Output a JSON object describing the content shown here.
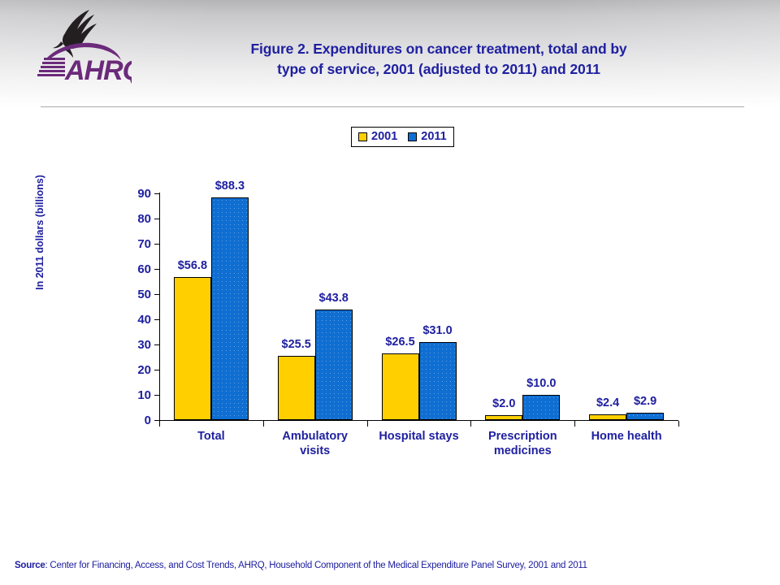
{
  "header": {
    "logo_alt": "AHRQ Agency for Healthcare Research and Quality",
    "title_line1": "Figure 2. Expenditures on cancer treatment, total and by",
    "title_line2": "type of service, 2001 (adjusted to 2011) and 2011"
  },
  "legend": {
    "items": [
      {
        "label": "2001",
        "color": "#ffcf00"
      },
      {
        "label": "2011",
        "color": "#0f6ed2"
      }
    ]
  },
  "source": {
    "prefix": "Source",
    "text": ": Center for Financing, Access, and Cost Trends, AHRQ,  Household Component of the Medical Expenditure Panel Survey,  2001 and  2011"
  },
  "chart_data": {
    "type": "bar",
    "title": "Figure 2. Expenditures on cancer treatment, total and by type of service, 2001 (adjusted to 2011) and 2011",
    "xlabel": "",
    "ylabel": "In 2011 dollars (billions)",
    "ylim": [
      0,
      90
    ],
    "yticks": [
      0,
      10,
      20,
      30,
      40,
      50,
      60,
      70,
      80,
      90
    ],
    "ytick_labels": [
      "0",
      "10",
      "20",
      "30",
      "40",
      "50",
      "60",
      "70",
      "80",
      "90"
    ],
    "grid": false,
    "legend_position": "top-center",
    "categories": [
      "Total",
      "Ambulatory\nvisits",
      "Hospital stays",
      "Prescription\nmedicines",
      "Home health"
    ],
    "series": [
      {
        "name": "2001",
        "color": "#ffcf00",
        "values": [
          56.8,
          25.5,
          26.5,
          2.0,
          2.4
        ],
        "labels": [
          "$56.8",
          "$25.5",
          "$26.5",
          "$2.0",
          "$2.4"
        ]
      },
      {
        "name": "2011",
        "color": "#0f6ed2",
        "values": [
          88.3,
          43.8,
          31.0,
          10.0,
          2.9
        ],
        "labels": [
          "$88.3",
          "$43.8",
          "$31.0",
          "$10.0",
          "$2.9"
        ]
      }
    ]
  }
}
